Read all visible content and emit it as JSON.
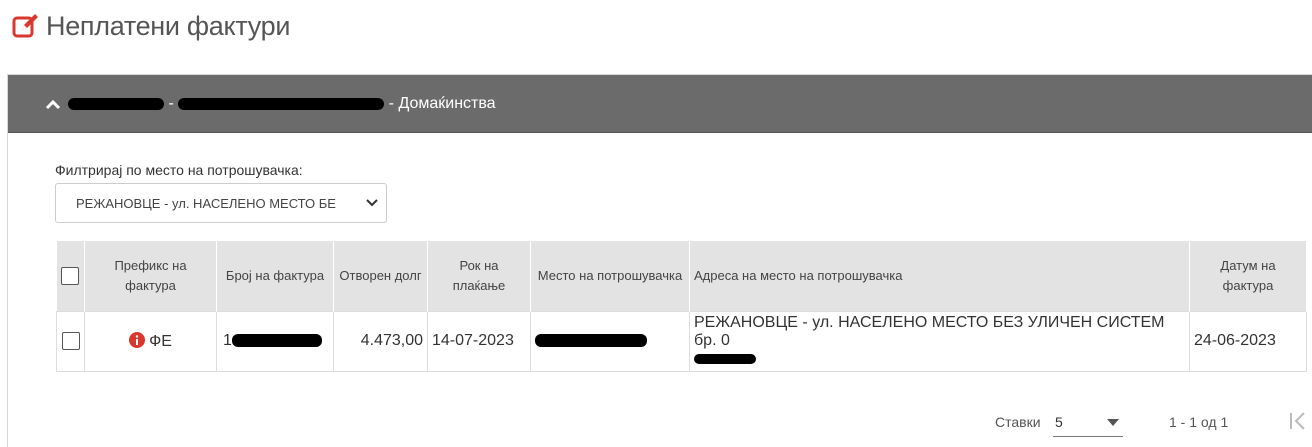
{
  "page": {
    "title": "Неплатени фактури"
  },
  "account": {
    "suffix": " - Домаќинства",
    "separator": " - "
  },
  "filter": {
    "label": "Филтрирај по место на потрошувачка:",
    "selected": "РЕЖАНОВЦЕ - ул. НАСЕЛЕНО МЕСТО БЕ"
  },
  "table": {
    "headers": {
      "prefix": "Префикс на фактура",
      "number": "Број на фактура",
      "open_debt": "Отворен долг",
      "due": "Рок на плаќање",
      "place": "Место на потрошувачка",
      "address": "Адреса на место на потрошувачка",
      "date": "Датум на фактура"
    },
    "rows": [
      {
        "prefix": "ФЕ",
        "number_visible": "1",
        "open_debt": "4.473,00",
        "due": "14-07-2023",
        "address": "РЕЖАНОВЦЕ - ул. НАСЕЛЕНО МЕСТО БЕЗ УЛИЧЕН СИСТЕМ бр. 0",
        "date": "24-06-2023"
      }
    ]
  },
  "pager": {
    "rows_label": "Ставки",
    "page_size": "5",
    "range": "1 - 1 од 1"
  },
  "colors": {
    "accent": "#d9382f",
    "panel_header": "#6b6b6b",
    "table_header": "#e3e3e3"
  }
}
